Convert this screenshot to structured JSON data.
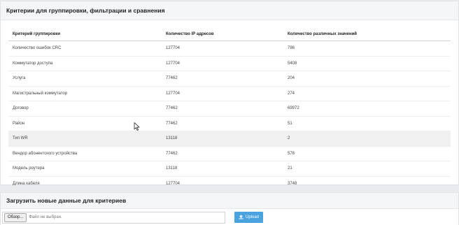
{
  "criteria_panel": {
    "title": "Критерии для группировки, фильтрации и сравнения",
    "columns": [
      "Критерий группировки",
      "Количество IP адресов",
      "Количество различных значений"
    ],
    "rows": [
      [
        "Количество ошибок CRC",
        "127704",
        "786"
      ],
      [
        "Коммутатор доступа",
        "127704",
        "5408"
      ],
      [
        "Услуга",
        "77462",
        "204"
      ],
      [
        "Магистральный коммутатор",
        "127704",
        "274"
      ],
      [
        "Договор",
        "77462",
        "69972"
      ],
      [
        "Район",
        "77462",
        "51"
      ],
      [
        "Тип WR",
        "13118",
        "2"
      ],
      [
        "Вендор абонентского устройства",
        "77462",
        "578"
      ],
      [
        "Модель роутера",
        "13118",
        "21"
      ],
      [
        "Длина кабеля",
        "127704",
        "3748"
      ]
    ],
    "highlighted_row": 6
  },
  "upload_panel": {
    "title": "Загрузить новые данные для критериев",
    "browse_label": "Обзор...",
    "file_status": "Файл не выбран.",
    "upload_label": "Upload",
    "upload_color": "#4aa3df",
    "upload_icon": "upload-icon"
  }
}
